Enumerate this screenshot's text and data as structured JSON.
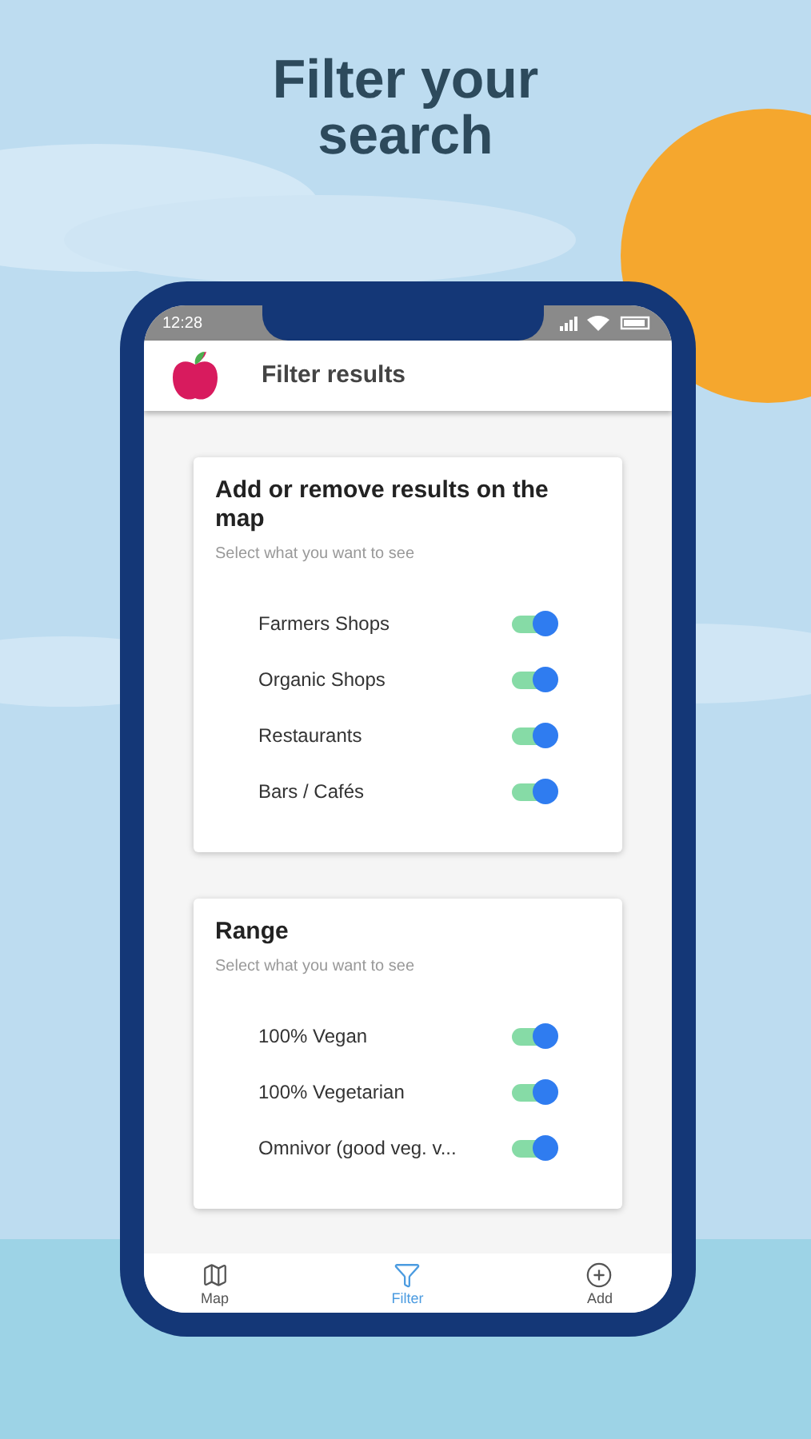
{
  "headline": "Filter your search",
  "status_bar": {
    "time": "12:28"
  },
  "app_bar": {
    "title": "Filter results"
  },
  "sections": [
    {
      "title": "Add or remove results on the map",
      "subtitle": "Select what you want to see",
      "options": [
        {
          "label": "Farmers Shops",
          "on": true
        },
        {
          "label": "Organic Shops",
          "on": true
        },
        {
          "label": "Restaurants",
          "on": true
        },
        {
          "label": "Bars / Cafés",
          "on": true
        }
      ]
    },
    {
      "title": "Range",
      "subtitle": "Select what you want to see",
      "options": [
        {
          "label": "100% Vegan",
          "on": true
        },
        {
          "label": "100% Vegetarian",
          "on": true
        },
        {
          "label": "Omnivor (good veg. v...",
          "on": true
        }
      ]
    }
  ],
  "bottom_nav": [
    {
      "label": "Map",
      "kind": "map",
      "selected": false
    },
    {
      "label": "Filter",
      "kind": "filter",
      "selected": true
    },
    {
      "label": "Add",
      "kind": "add",
      "selected": false
    }
  ]
}
